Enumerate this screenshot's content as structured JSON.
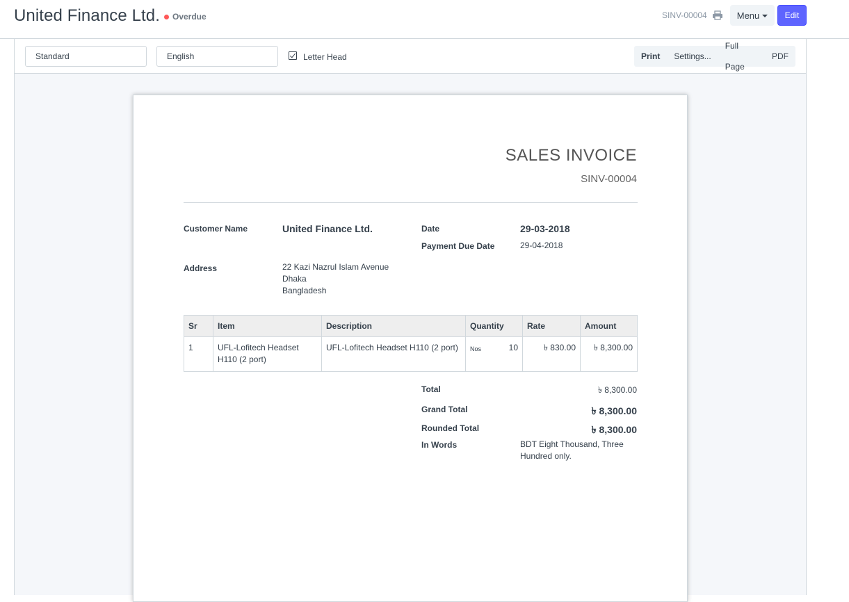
{
  "header": {
    "title": "United Finance Ltd.",
    "status": "Overdue",
    "status_color": "#ff5858",
    "doc_name": "SINV-00004",
    "print_icon": "print-icon",
    "menu_label": "Menu",
    "edit_label": "Edit",
    "accent_color": "#5e64ff"
  },
  "toolbar": {
    "print_format": "Standard",
    "language": "English",
    "letter_head_label": "Letter Head",
    "letter_head_checked": true,
    "buttons": [
      "Print",
      "Settings...",
      "Full Page",
      "PDF"
    ]
  },
  "invoice": {
    "heading": "SALES INVOICE",
    "number": "SINV-00004",
    "customer_label": "Customer Name",
    "customer_value": "United Finance Ltd.",
    "date_label": "Date",
    "date_value": "29-03-2018",
    "due_label": "Payment Due Date",
    "due_value": "29-04-2018",
    "address_label": "Address",
    "address_lines": [
      "22 Kazi Nazrul Islam Avenue",
      "Dhaka",
      "Bangladesh"
    ],
    "columns": [
      "Sr",
      "Item",
      "Description",
      "Quantity",
      "Rate",
      "Amount"
    ],
    "rows": [
      {
        "sr": "1",
        "item": "UFL-Lofitech Headset H110 (2 port)",
        "description": "UFL-Lofitech Headset H110 (2 port)",
        "uom": "Nos",
        "qty": "10",
        "rate": "৳ 830.00",
        "amount": "৳ 8,300.00"
      }
    ],
    "totals": {
      "total_label": "Total",
      "total_value": "৳ 8,300.00",
      "grand_label": "Grand Total",
      "grand_value": "৳ 8,300.00",
      "rounded_label": "Rounded Total",
      "rounded_value": "৳ 8,300.00",
      "words_label": "In Words",
      "words_value": "BDT Eight Thousand, Three Hundred only."
    }
  }
}
